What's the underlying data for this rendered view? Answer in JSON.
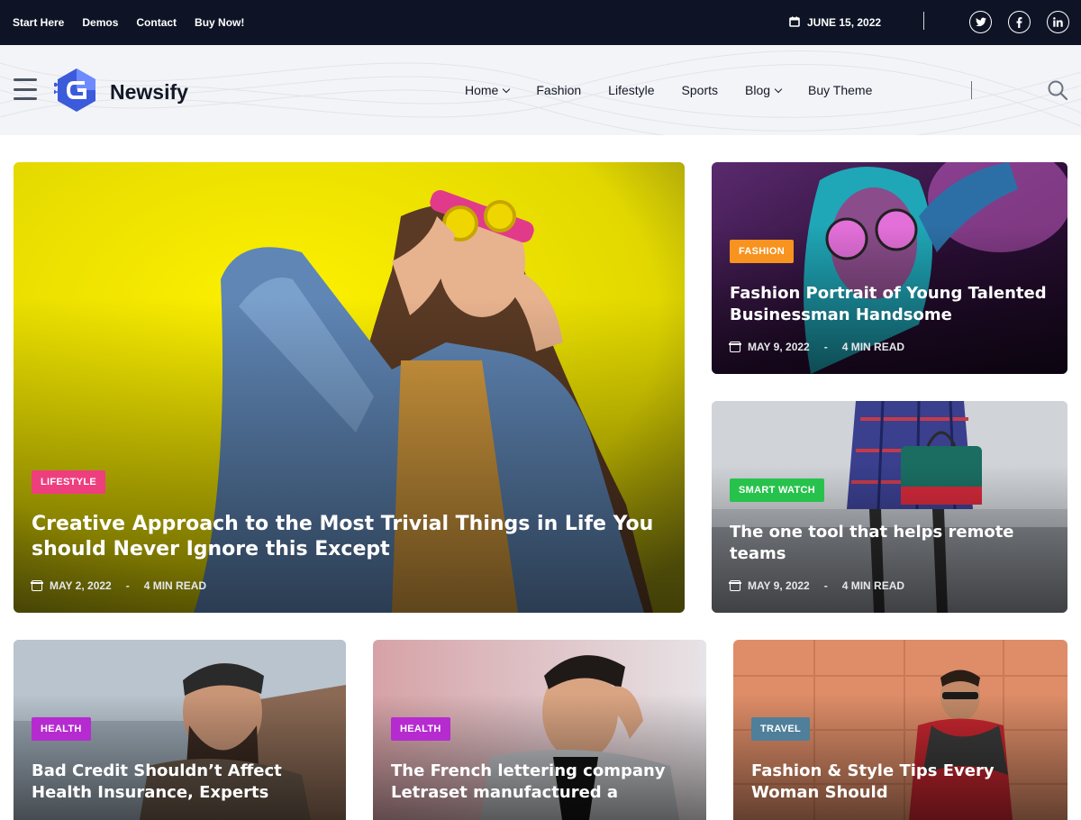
{
  "topbar": {
    "links": [
      "Start Here",
      "Demos",
      "Contact",
      "Buy Now!"
    ],
    "date": "JUNE 15, 2022",
    "socials": [
      {
        "icon": "twitter-icon",
        "glyph": "t"
      },
      {
        "icon": "facebook-icon",
        "glyph": "f"
      },
      {
        "icon": "linkedin-icon",
        "glyph": "in"
      }
    ]
  },
  "header": {
    "logo_text": "Newsify",
    "nav": [
      {
        "label": "Home",
        "dropdown": true
      },
      {
        "label": "Fashion",
        "dropdown": false
      },
      {
        "label": "Lifestyle",
        "dropdown": false
      },
      {
        "label": "Sports",
        "dropdown": false
      },
      {
        "label": "Blog",
        "dropdown": true
      },
      {
        "label": "Buy Theme",
        "dropdown": false
      }
    ]
  },
  "colors": {
    "topbar_bg": "#0e1425",
    "lifestyle": "#ee3e7e",
    "fashion": "#f7931e",
    "smart_watch": "#27c24c",
    "health": "#b52bd0",
    "travel": "#4f7f9a"
  },
  "posts": {
    "hero": {
      "category": "LIFESTYLE",
      "title": "Creative Approach to the Most Trivial Things in Life You should Never Ignore this Except",
      "date": "MAY 2, 2022",
      "read": "4 MIN READ"
    },
    "side1": {
      "category": "FASHION",
      "title": "Fashion Portrait of Young Talented Businessman Handsome",
      "date": "MAY 9, 2022",
      "read": "4 MIN READ"
    },
    "side2": {
      "category": "SMART WATCH",
      "title": "The one tool that helps remote teams",
      "date": "MAY 9, 2022",
      "read": "4 MIN READ"
    },
    "row": [
      {
        "category": "HEALTH",
        "title": "Bad Credit Shouldn’t Affect Health Insurance, Experts"
      },
      {
        "category": "HEALTH",
        "title": "The French lettering company Letraset manufactured a"
      },
      {
        "category": "TRAVEL",
        "title": "Fashion & Style Tips Every Woman Should"
      }
    ]
  }
}
